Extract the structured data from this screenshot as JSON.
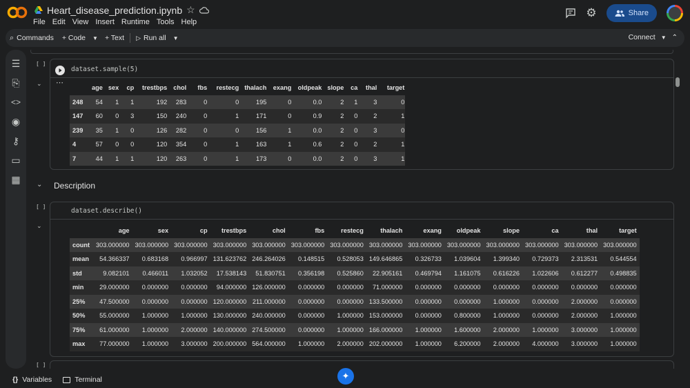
{
  "header": {
    "filename": "Heart_disease_prediction.ipynb",
    "menus": [
      "File",
      "Edit",
      "View",
      "Insert",
      "Runtime",
      "Tools",
      "Help"
    ],
    "share_label": "Share"
  },
  "toolbar": {
    "commands_label": "Commands",
    "code_label": "+ Code",
    "text_label": "+ Text",
    "run_all_label": "Run all",
    "connect_label": "Connect"
  },
  "cell1": {
    "bracket": "[ ]",
    "code": "dataset.sample(5)",
    "columns": [
      "",
      "age",
      "sex",
      "cp",
      "trestbps",
      "chol",
      "fbs",
      "restecg",
      "thalach",
      "exang",
      "oldpeak",
      "slope",
      "ca",
      "thal",
      "target"
    ],
    "rows": [
      [
        "248",
        "54",
        "1",
        "1",
        "192",
        "283",
        "0",
        "0",
        "195",
        "0",
        "0.0",
        "2",
        "1",
        "3",
        "0"
      ],
      [
        "147",
        "60",
        "0",
        "3",
        "150",
        "240",
        "0",
        "1",
        "171",
        "0",
        "0.9",
        "2",
        "0",
        "2",
        "1"
      ],
      [
        "239",
        "35",
        "1",
        "0",
        "126",
        "282",
        "0",
        "0",
        "156",
        "1",
        "0.0",
        "2",
        "0",
        "3",
        "0"
      ],
      [
        "4",
        "57",
        "0",
        "0",
        "120",
        "354",
        "0",
        "1",
        "163",
        "1",
        "0.6",
        "2",
        "0",
        "2",
        "1"
      ],
      [
        "7",
        "44",
        "1",
        "1",
        "120",
        "263",
        "0",
        "1",
        "173",
        "0",
        "0.0",
        "2",
        "0",
        "3",
        "1"
      ]
    ]
  },
  "section": {
    "title": "Description"
  },
  "cell2": {
    "bracket": "[ ]",
    "code": "dataset.describe()",
    "columns": [
      "",
      "age",
      "sex",
      "cp",
      "trestbps",
      "chol",
      "fbs",
      "restecg",
      "thalach",
      "exang",
      "oldpeak",
      "slope",
      "ca",
      "thal",
      "target"
    ],
    "rows": [
      [
        "count",
        "303.000000",
        "303.000000",
        "303.000000",
        "303.000000",
        "303.000000",
        "303.000000",
        "303.000000",
        "303.000000",
        "303.000000",
        "303.000000",
        "303.000000",
        "303.000000",
        "303.000000",
        "303.000000"
      ],
      [
        "mean",
        "54.366337",
        "0.683168",
        "0.966997",
        "131.623762",
        "246.264026",
        "0.148515",
        "0.528053",
        "149.646865",
        "0.326733",
        "1.039604",
        "1.399340",
        "0.729373",
        "2.313531",
        "0.544554"
      ],
      [
        "std",
        "9.082101",
        "0.466011",
        "1.032052",
        "17.538143",
        "51.830751",
        "0.356198",
        "0.525860",
        "22.905161",
        "0.469794",
        "1.161075",
        "0.616226",
        "1.022606",
        "0.612277",
        "0.498835"
      ],
      [
        "min",
        "29.000000",
        "0.000000",
        "0.000000",
        "94.000000",
        "126.000000",
        "0.000000",
        "0.000000",
        "71.000000",
        "0.000000",
        "0.000000",
        "0.000000",
        "0.000000",
        "0.000000",
        "0.000000"
      ],
      [
        "25%",
        "47.500000",
        "0.000000",
        "0.000000",
        "120.000000",
        "211.000000",
        "0.000000",
        "0.000000",
        "133.500000",
        "0.000000",
        "0.000000",
        "1.000000",
        "0.000000",
        "2.000000",
        "0.000000"
      ],
      [
        "50%",
        "55.000000",
        "1.000000",
        "1.000000",
        "130.000000",
        "240.000000",
        "0.000000",
        "1.000000",
        "153.000000",
        "0.000000",
        "0.800000",
        "1.000000",
        "0.000000",
        "2.000000",
        "1.000000"
      ],
      [
        "75%",
        "61.000000",
        "1.000000",
        "2.000000",
        "140.000000",
        "274.500000",
        "0.000000",
        "1.000000",
        "166.000000",
        "1.000000",
        "1.600000",
        "2.000000",
        "1.000000",
        "3.000000",
        "1.000000"
      ],
      [
        "max",
        "77.000000",
        "1.000000",
        "3.000000",
        "200.000000",
        "564.000000",
        "1.000000",
        "2.000000",
        "202.000000",
        "1.000000",
        "6.200000",
        "2.000000",
        "4.000000",
        "3.000000",
        "1.000000"
      ]
    ]
  },
  "bottom": {
    "variables_label": "Variables",
    "terminal_label": "Terminal"
  }
}
